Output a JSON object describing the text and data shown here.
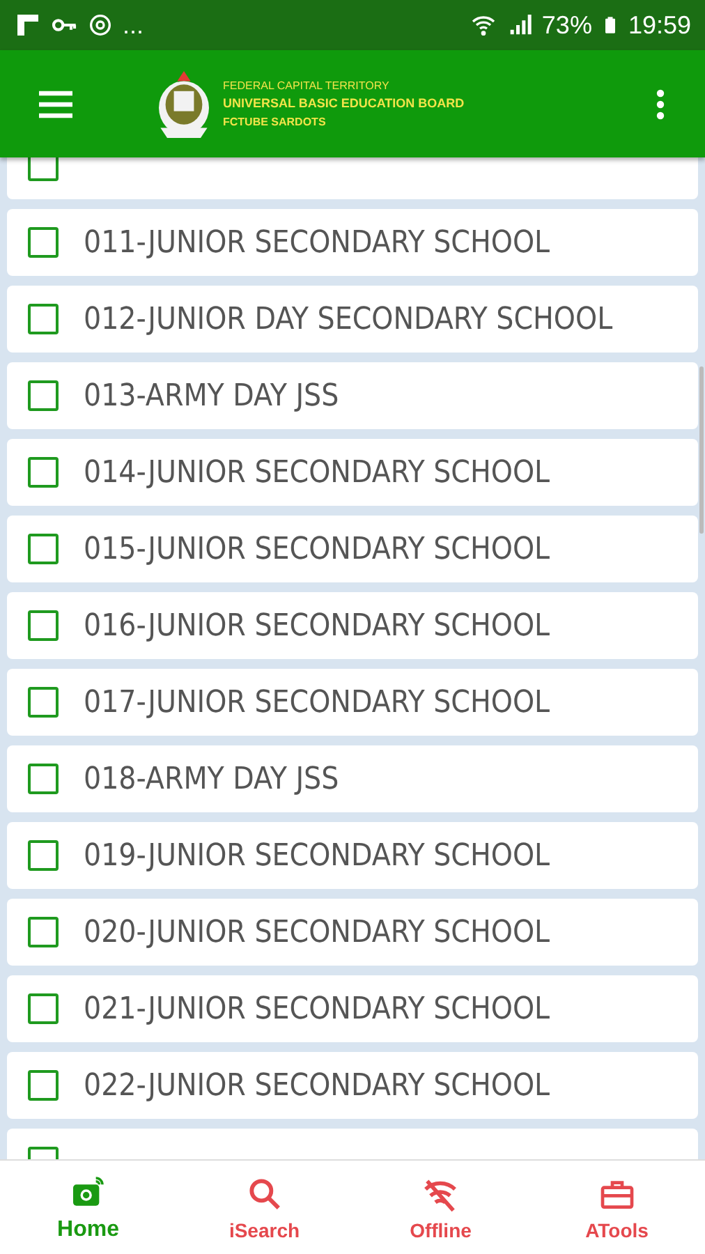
{
  "status_bar": {
    "more": "...",
    "battery": "73%",
    "time": "19:59"
  },
  "app_bar": {
    "logo_lines": [
      "FEDERAL CAPITAL TERRITORY",
      "UNIVERSAL BASIC EDUCATION BOARD",
      "FCTUBE  SARDOTS"
    ]
  },
  "schools": [
    {
      "checked": false
    },
    {
      "name": "011-JUNIOR SECONDARY SCHOOL",
      "checked": false
    },
    {
      "name": "012-JUNIOR DAY SECONDARY SCHOOL",
      "checked": false
    },
    {
      "name": "013-ARMY DAY JSS",
      "checked": false
    },
    {
      "name": "014-JUNIOR SECONDARY SCHOOL",
      "checked": false
    },
    {
      "name": "015-JUNIOR SECONDARY SCHOOL",
      "checked": false
    },
    {
      "name": "016-JUNIOR SECONDARY SCHOOL",
      "checked": false
    },
    {
      "name": "017-JUNIOR SECONDARY SCHOOL",
      "checked": false
    },
    {
      "name": "018-ARMY DAY JSS",
      "checked": false
    },
    {
      "name": "019-JUNIOR SECONDARY SCHOOL",
      "checked": false
    },
    {
      "name": "020-JUNIOR SECONDARY SCHOOL",
      "checked": false
    },
    {
      "name": "021-JUNIOR SECONDARY SCHOOL",
      "checked": false
    },
    {
      "name": "022-JUNIOR SECONDARY SCHOOL",
      "checked": false
    },
    {
      "checked": false
    }
  ],
  "bottom_nav": [
    {
      "kind": "camera",
      "label": "Home",
      "selected": true
    },
    {
      "kind": "search",
      "label": "iSearch",
      "selected": false
    },
    {
      "kind": "offline",
      "label": "Offline",
      "selected": false
    },
    {
      "kind": "toolbox",
      "label": "ATools",
      "selected": false
    }
  ]
}
